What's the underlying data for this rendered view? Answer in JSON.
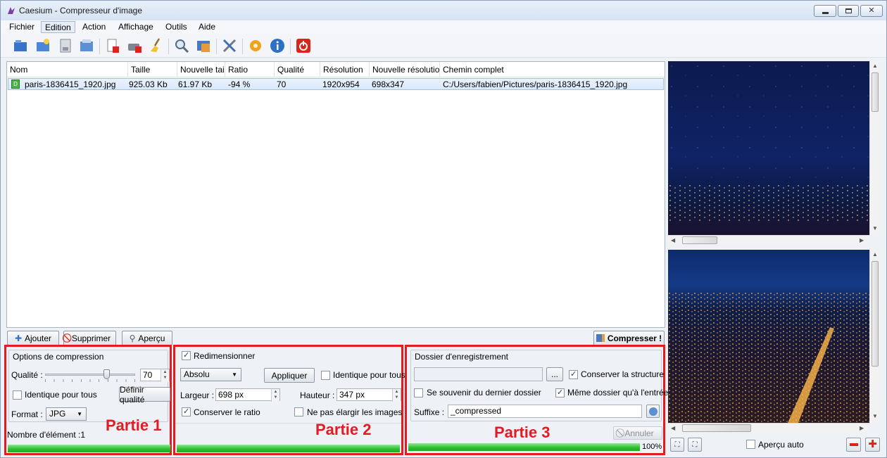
{
  "window": {
    "title": "Caesium - Compresseur d'image"
  },
  "menu": [
    "Fichier",
    "Edition",
    "Action",
    "Affichage",
    "Outils",
    "Aide"
  ],
  "table": {
    "columns": [
      "Nom",
      "Taille",
      "Nouvelle tai",
      "Ratio",
      "Qualité",
      "Résolution",
      "Nouvelle résolutio",
      "Chemin complet"
    ],
    "rows": [
      {
        "icon_letter": "D",
        "name": "paris-1836415_1920.jpg",
        "size": "925.03 Kb",
        "new_size": "61.97 Kb",
        "ratio": "-94 %",
        "quality": "70",
        "resolution": "1920x954",
        "new_resolution": "698x347",
        "path": "C:/Users/fabien/Pictures/paris-1836415_1920.jpg"
      }
    ]
  },
  "buttons": {
    "add": "Ajouter",
    "remove": "Supprimer",
    "preview": "Aperçu",
    "compress": "Compresser !"
  },
  "compression": {
    "group_title": "Options de compression",
    "quality_label": "Qualité :",
    "quality_value": "70",
    "quality_slider_fraction": 0.7,
    "same_for_all": "Identique pour tous",
    "define_quality": "Définir qualité",
    "format_label": "Format :",
    "format_value": "JPG",
    "count_label": "Nombre d'élément :1"
  },
  "resize": {
    "enable_label": "Redimensionner",
    "mode": "Absolu",
    "apply": "Appliquer",
    "same_for_all": "Identique pour tous",
    "width_label": "Largeur :",
    "width_value": "698 px",
    "height_label": "Hauteur :",
    "height_value": "347 px",
    "keep_ratio": "Conserver le ratio",
    "no_enlarge": "Ne pas élargir les images"
  },
  "output": {
    "group_title": "Dossier d'enregistrement",
    "folder_value": "",
    "browse": "...",
    "keep_structure": "Conserver la structure",
    "remember_last": "Se souvenir du dernier dossier",
    "same_folder": "Même dossier qu'à l'entrée",
    "suffix_label": "Suffixe :",
    "suffix_value": "_compressed",
    "cancel": "Annuler"
  },
  "progress": {
    "percent_label": "100%",
    "fraction": 1.0
  },
  "annotations": {
    "part1": "Partie 1",
    "part2": "Partie 2",
    "part3": "Partie 3"
  },
  "preview_panel": {
    "auto_preview": "Aperçu auto"
  },
  "colors": {
    "annotation_red": "#e31b23",
    "progress_green": "#2fbf34",
    "selection_blue": "#d9e9fb"
  }
}
